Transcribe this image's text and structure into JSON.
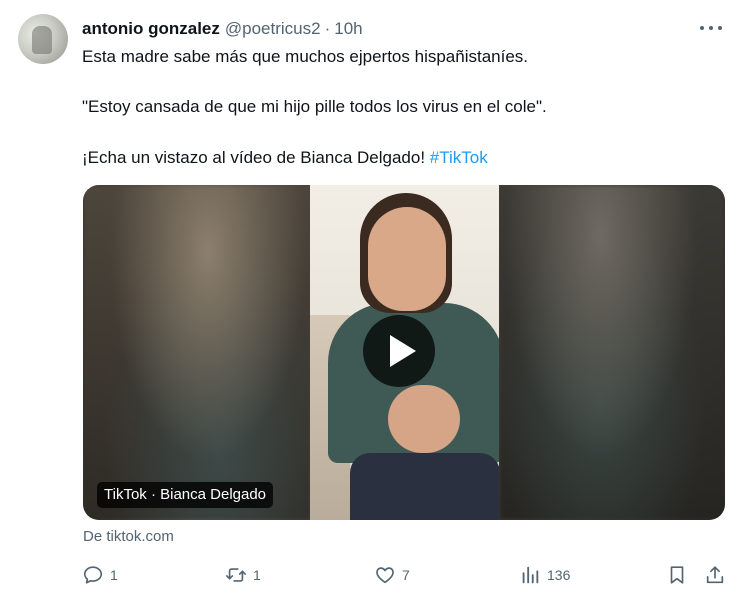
{
  "author": {
    "name": "antonio gonzalez",
    "handle": "@poetricus2",
    "separator": "·",
    "time": "10h"
  },
  "tweet": {
    "line1": "Esta madre sabe más que muchos ejpertos hispañistaníes.",
    "line2": "\"Estoy cansada de que mi hijo pille todos los virus en el cole\".",
    "line3": "¡Echa un vistazo al vídeo de Bianca Delgado! ",
    "hashtag": "#TikTok"
  },
  "media": {
    "label": "TikTok · Bianca Delgado",
    "source": "De tiktok.com"
  },
  "actions": {
    "replies": "1",
    "retweets": "1",
    "likes": "7",
    "views": "136"
  },
  "colors": {
    "accent": "#1d9bf0",
    "text": "#0f1419",
    "muted": "#536471"
  }
}
